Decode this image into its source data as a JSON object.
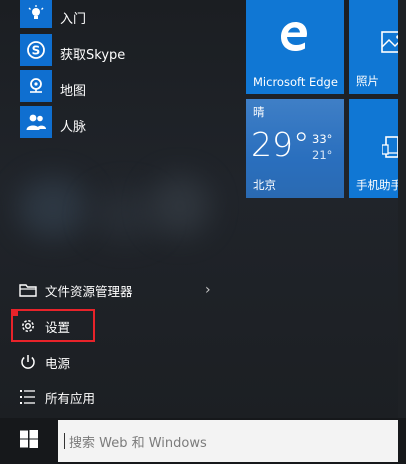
{
  "apps": [
    {
      "label": "入门",
      "icon": "lightbulb-icon"
    },
    {
      "label": "获取Skype",
      "icon": "skype-icon"
    },
    {
      "label": "地图",
      "icon": "maps-icon"
    },
    {
      "label": "人脉",
      "icon": "people-icon"
    }
  ],
  "system": {
    "file_explorer": "文件资源管理器",
    "settings": "设置",
    "power": "电源",
    "all_apps": "所有应用"
  },
  "tiles": {
    "edge": "Microsoft Edge",
    "photos": "照片",
    "weather": {
      "condition": "晴",
      "temp": "29°",
      "high": "33°",
      "low": "21°",
      "city": "北京"
    },
    "phone": "手机助手"
  },
  "taskbar": {
    "search_placeholder": "搜索 Web 和 Windows"
  },
  "colors": {
    "accent": "#0f6fd0",
    "tile_blue": "#1077d4",
    "weather_tile": "#2a6fbe",
    "highlight": "#e8232a"
  }
}
